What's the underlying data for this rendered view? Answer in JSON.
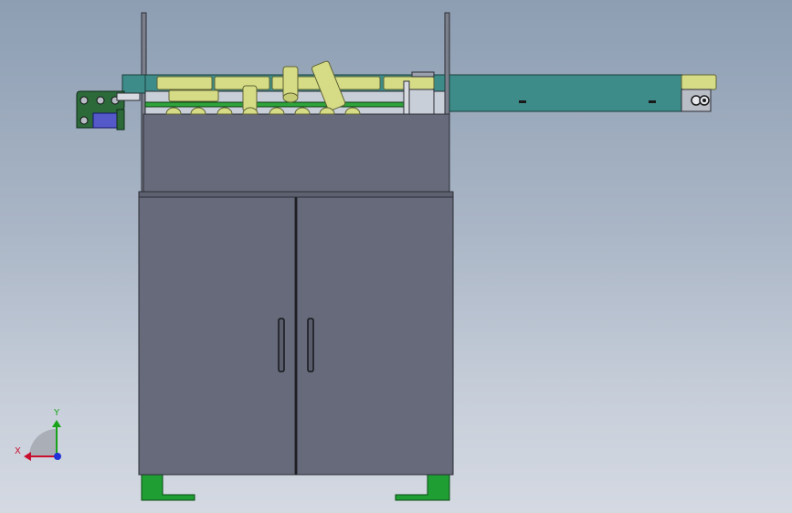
{
  "triad": {
    "x_label": "X",
    "y_label": "Y",
    "colors": {
      "x": "#c8102e",
      "y": "#19a319",
      "z": "#1f33d8"
    }
  },
  "colors": {
    "cabinet": "#666a7a",
    "cabinet_edge": "#2b2d35",
    "conveyor_teal": "#3d8c8a",
    "roller_yellow": "#d6dc86",
    "frame_green": "#2ea43a",
    "foot_green": "#1f9e33",
    "slider_blue": "#5458c9"
  }
}
